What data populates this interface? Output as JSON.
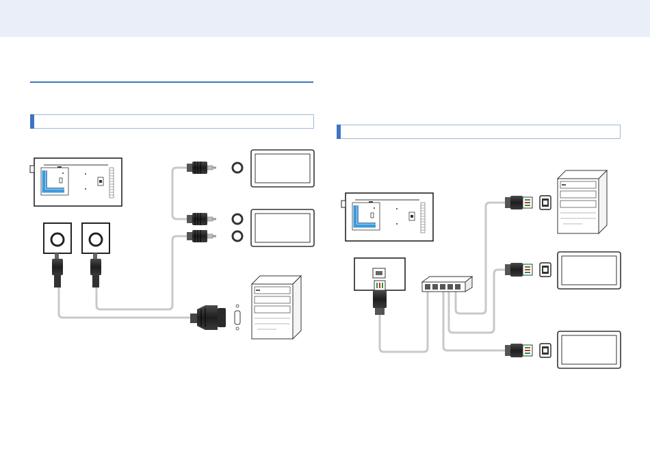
{
  "page": {
    "top_band_color": "#e9eef9",
    "accent_color": "#3b75c4",
    "section_left": {
      "label": ""
    },
    "section_right": {
      "label": ""
    }
  },
  "icons": {
    "left": [
      "display-rear-panel-icon",
      "speaker-icon",
      "speaker-icon",
      "audio-plug-icon",
      "audio-plug-icon",
      "audio-plug-icon",
      "monitor-icon",
      "monitor-icon",
      "vga-connector-icon",
      "pc-tower-icon"
    ],
    "right": [
      "display-rear-panel-icon",
      "lan-port-icon",
      "network-hub-icon",
      "rj45-plug-icon",
      "rj45-plug-icon",
      "rj45-plug-icon",
      "pc-tower-icon",
      "monitor-icon",
      "monitor-icon"
    ]
  }
}
